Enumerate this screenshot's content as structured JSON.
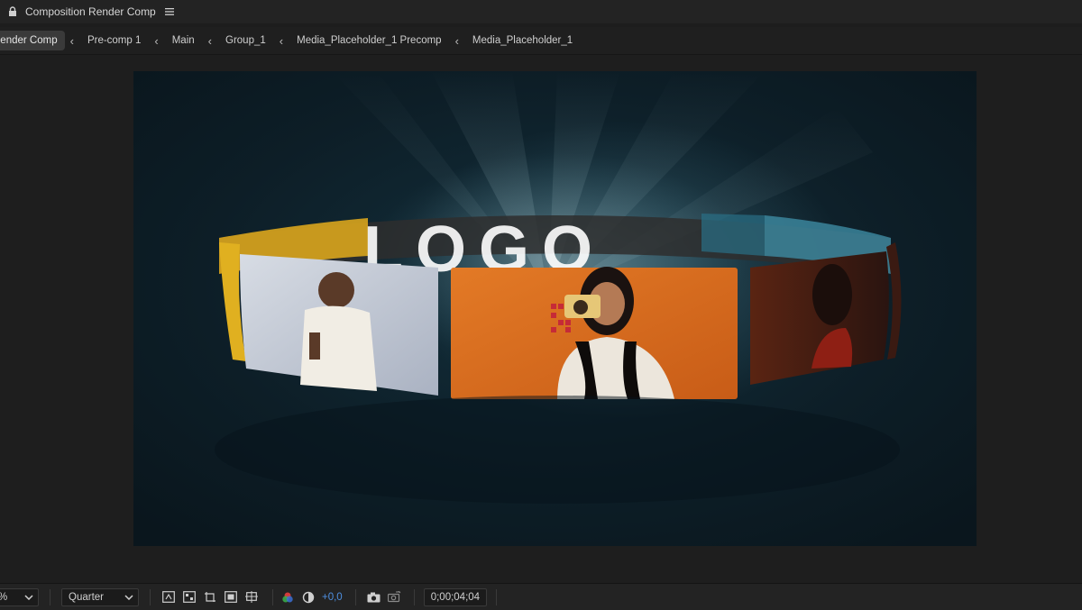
{
  "panel": {
    "title": "Composition Render Comp",
    "lock_icon": "lock-icon",
    "menu_icon": "hamburger-menu-icon"
  },
  "breadcrumbs": [
    {
      "label": "Render Comp",
      "active": true
    },
    {
      "label": "Pre-comp 1",
      "active": false
    },
    {
      "label": "Main",
      "active": false
    },
    {
      "label": "Group_1",
      "active": false
    },
    {
      "label": "Media_Placeholder_1 Precomp",
      "active": false
    },
    {
      "label": "Media_Placeholder_1",
      "active": false
    }
  ],
  "viewer": {
    "preview_overlay_text": "LOGO",
    "media_panels": [
      {
        "name": "man-thumbs-up",
        "background": "#c9d0dc"
      },
      {
        "name": "woman-with-camera",
        "background": "#d86a1e"
      },
      {
        "name": "woman-in-red",
        "background": "#3a1e12"
      }
    ]
  },
  "toolbar": {
    "magnification_value": "%",
    "resolution_value": "Quarter",
    "exposure_value": "+0,0",
    "current_time": "0;00;04;04",
    "icons": [
      "fast-previews-icon",
      "transparency-grid-icon",
      "region-of-interest-icon",
      "mask-visibility-icon",
      "guides-options-icon",
      "color-channel-icon",
      "reset-exposure-icon",
      "snapshot-camera-icon",
      "show-snapshot-icon"
    ]
  },
  "colors": {
    "accent_blue": "#4e8fe0",
    "panel_bg": "#1d1d1d",
    "frame_bg": "#0d1e27"
  }
}
